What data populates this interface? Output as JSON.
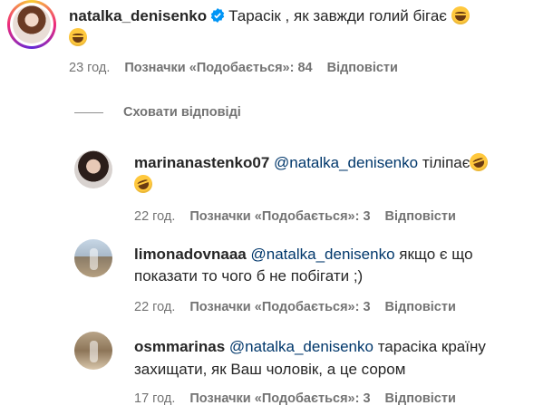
{
  "main_comment": {
    "username": "natalka_denisenko",
    "text": "Тарасік , як завжди голий бігає",
    "time": "23 год.",
    "likes": "Позначки «Подобається»: 84",
    "reply": "Відповісти"
  },
  "hide_replies_label": "Сховати відповіді",
  "replies": [
    {
      "username": "marinanastenko07",
      "mention": "@natalka_denisenko",
      "text": "тіліпає",
      "time": "22 год.",
      "likes": "Позначки «Подобається»: 3",
      "reply": "Відповісти"
    },
    {
      "username": "limonadovnaaa",
      "mention": "@natalka_denisenko",
      "text_line1": "якщо є що",
      "text_line2": "показати то чого б не побігати ;)",
      "time": "22 год.",
      "likes": "Позначки «Подобається»: 3",
      "reply": "Відповісти"
    },
    {
      "username": "osmmarinas",
      "mention": "@natalka_denisenko",
      "text_line1": "тарасіка країну",
      "text_line2": "захищати, як Ваш чоловік, а це сором",
      "time": "17 год.",
      "likes": "Позначки «Подобається»: 3",
      "reply": "Відповісти"
    }
  ],
  "icons": {
    "verified": "verified-badge-icon",
    "emoji_laugh": "tears-of-joy-emoji-icon",
    "emoji_rofl": "rolling-laughing-emoji-icon"
  },
  "colors": {
    "verified": "#0095f6",
    "mention": "#00376b",
    "muted": "#737373"
  }
}
